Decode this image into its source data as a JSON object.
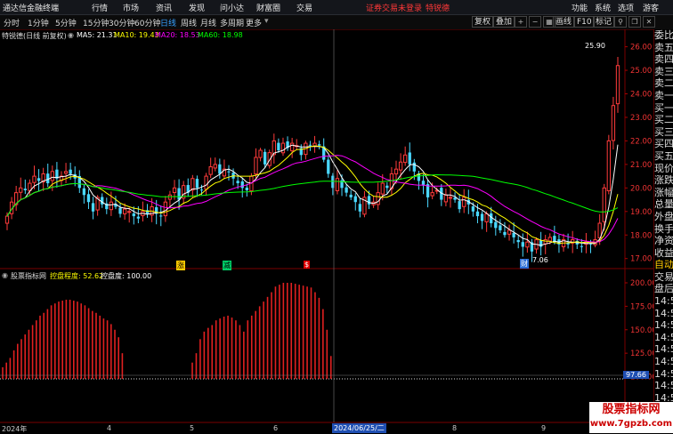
{
  "app": {
    "title": "通达信金融终端",
    "menu": [
      "行情",
      "市场",
      "资讯",
      "发现",
      "问小达",
      "财富圈",
      "交易"
    ],
    "notice": "证券交易未登录",
    "stock_name": "特锐德",
    "right_menu": [
      "功能",
      "系统",
      "选项"
    ],
    "guest": "游客"
  },
  "toolbar": {
    "periods": [
      "分时",
      "1分钟",
      "5分钟",
      "15分钟",
      "30分钟",
      "60分钟",
      "日线",
      "周线",
      "月线",
      "多周期",
      "更多"
    ],
    "active_period": "日线",
    "right_buttons": [
      "复权",
      "叠加",
      "画线",
      "F10",
      "标记"
    ],
    "icon_names": [
      "add-icon",
      "minus-icon",
      "grid-icon"
    ]
  },
  "chart_header": {
    "stock": "特锐德(日线 前复权)",
    "ma5": "MA5: 21.31",
    "ma10": "MA10: 19.43",
    "ma20": "MA20: 18.53",
    "ma60": "MA60: 18.98",
    "colors": {
      "ma5": "#ffffff",
      "ma10": "#ffff00",
      "ma20": "#ff00ff",
      "ma60": "#00ff00"
    }
  },
  "indicator_header": {
    "source": "股票指标网",
    "label1": "控盘程度: 52.62",
    "label2": "控盘度: 100.00"
  },
  "price_annotations": {
    "high": "25.90",
    "low": "7.06"
  },
  "markers": [
    "涨",
    "减",
    "$",
    "财"
  ],
  "cursor_value": "97.66",
  "date_axis": [
    "2024年",
    "4",
    "5",
    "6",
    "2024/06/25/二",
    "8",
    "9"
  ],
  "right_panel": [
    "委比",
    "卖五",
    "卖四",
    "卖三",
    "卖二",
    "卖一",
    "买一",
    "买二",
    "买三",
    "买四",
    "买五",
    "现价",
    "涨跌",
    "涨幅",
    "总量",
    "外盘",
    "换手",
    "净资",
    "收益",
    "自动",
    "交易",
    "盘后",
    "14:50",
    "14:50",
    "14:50",
    "14:50",
    "14:50",
    "14:50",
    "14:50",
    "14:50",
    "14:50",
    "14:50"
  ],
  "watermark": {
    "line1": "股票指标网",
    "line2": "www.7gpzb.com"
  },
  "chart_data": [
    {
      "type": "candlestick",
      "y_axis_labels": [
        "26.00",
        "25.00",
        "24.00",
        "23.00",
        "22.00",
        "21.00",
        "20.00",
        "19.00",
        "18.00",
        "17.00"
      ],
      "ylim": [
        16.8,
        26.4
      ],
      "closes": [
        18.8,
        19.4,
        19.8,
        20.0,
        19.9,
        20.2,
        20.5,
        20.3,
        20.6,
        20.2,
        20.7,
        20.4,
        20.5,
        20.7,
        20.6,
        20.4,
        20.0,
        19.7,
        19.4,
        19.0,
        19.6,
        19.3,
        19.1,
        19.4,
        19.2,
        18.9,
        19.1,
        19.0,
        18.8,
        18.7,
        19.0,
        18.9,
        19.2,
        18.9,
        18.8,
        19.4,
        19.7,
        20.0,
        19.5,
        20.1,
        19.8,
        20.4,
        20.0,
        19.9,
        20.5,
        20.9,
        21.0,
        20.6,
        20.8,
        20.7,
        20.4,
        20.2,
        20.0,
        19.9,
        20.5,
        21.3,
        21.6,
        21.0,
        21.5,
        22.0,
        21.6,
        21.9,
        21.7,
        21.9,
        21.8,
        21.4,
        21.9,
        21.8,
        21.9,
        21.8,
        21.2,
        20.6,
        20.0,
        20.4,
        20.0,
        19.8,
        19.6,
        19.4,
        19.0,
        19.6,
        19.3,
        19.4,
        19.8,
        20.2,
        20.0,
        20.6,
        20.8,
        21.1,
        21.4,
        21.0,
        20.7,
        20.3,
        20.1,
        19.6,
        19.8,
        19.9,
        19.5,
        19.7,
        19.6,
        19.5,
        19.1,
        19.6,
        19.3,
        19.0,
        18.8,
        18.6,
        18.9,
        18.5,
        18.3,
        18.2,
        18.0,
        18.2,
        17.9,
        17.7,
        17.5,
        17.7,
        17.3,
        17.8,
        17.5,
        17.8,
        17.9,
        17.7,
        17.6,
        17.8,
        17.6,
        17.8,
        17.6,
        17.5,
        17.7,
        17.6,
        17.8,
        18.5,
        20.0,
        22.0,
        23.5,
        25.2
      ],
      "ma_series": [
        {
          "name": "MA5",
          "value": 21.31
        },
        {
          "name": "MA10",
          "value": 19.43
        },
        {
          "name": "MA20",
          "value": 18.53
        },
        {
          "name": "MA60",
          "value": 18.98
        }
      ]
    },
    {
      "type": "bar",
      "title": "控盘程度",
      "y_axis_labels": [
        "200.00",
        "175.00",
        "150.00",
        "125.00",
        "100.00"
      ],
      "ylim": [
        97.66,
        200
      ],
      "values": [
        110,
        115,
        120,
        128,
        135,
        140,
        145,
        150,
        155,
        160,
        165,
        168,
        172,
        176,
        178,
        180,
        181,
        182,
        182,
        181,
        180,
        178,
        176,
        173,
        170,
        168,
        165,
        162,
        160,
        156,
        150,
        142,
        125,
        115,
        125,
        140,
        148,
        152,
        155,
        160,
        162,
        164,
        165,
        163,
        160,
        155,
        148,
        160,
        165,
        170,
        175,
        180,
        185,
        190,
        196,
        198,
        200,
        200,
        200,
        199,
        198,
        197,
        196,
        195,
        190,
        184,
        172,
        150,
        122
      ]
    }
  ]
}
